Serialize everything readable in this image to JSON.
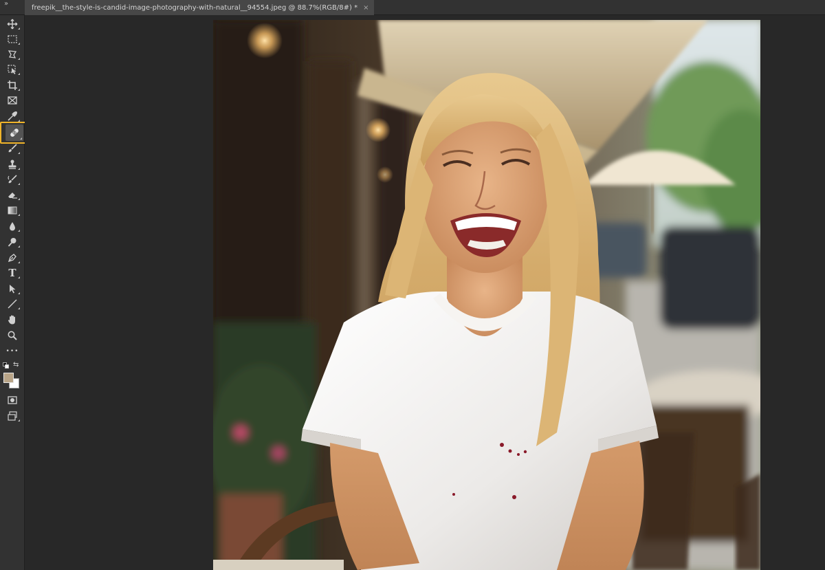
{
  "document": {
    "tab_title": "freepik__the-style-is-candid-image-photography-with-natural__94554.jpeg @ 88.7%(RGB/8#) *",
    "close_glyph": "×"
  },
  "toolbar": {
    "collapse_glyph": "»",
    "tools": [
      {
        "name": "move-tool",
        "icon": "move-icon"
      },
      {
        "name": "rectangular-marquee-tool",
        "icon": "marquee-icon"
      },
      {
        "name": "lasso-tool",
        "icon": "lasso-icon"
      },
      {
        "name": "object-selection-tool",
        "icon": "object-select-icon"
      },
      {
        "name": "crop-tool",
        "icon": "crop-icon"
      },
      {
        "name": "frame-tool",
        "icon": "frame-icon"
      },
      {
        "name": "eyedropper-tool",
        "icon": "eyedropper-icon"
      },
      {
        "name": "spot-healing-brush-tool",
        "icon": "bandage-icon",
        "selected": true
      },
      {
        "name": "brush-tool",
        "icon": "brush-icon"
      },
      {
        "name": "clone-stamp-tool",
        "icon": "stamp-icon"
      },
      {
        "name": "history-brush-tool",
        "icon": "history-brush-icon"
      },
      {
        "name": "eraser-tool",
        "icon": "eraser-icon"
      },
      {
        "name": "gradient-tool",
        "icon": "gradient-icon"
      },
      {
        "name": "blur-tool",
        "icon": "drop-icon"
      },
      {
        "name": "dodge-tool",
        "icon": "dodge-icon"
      },
      {
        "name": "pen-tool",
        "icon": "pen-icon"
      },
      {
        "name": "type-tool",
        "icon": "type-icon"
      },
      {
        "name": "path-selection-tool",
        "icon": "arrow-icon"
      },
      {
        "name": "line-tool",
        "icon": "line-icon"
      },
      {
        "name": "hand-tool",
        "icon": "hand-icon"
      },
      {
        "name": "zoom-tool",
        "icon": "zoom-icon"
      },
      {
        "name": "edit-toolbar",
        "icon": "more-icon"
      }
    ],
    "type_glyph": "T",
    "more_glyph": "•••",
    "swap_glyph": "⇆",
    "foreground_color": "#b8a487",
    "background_color": "#ffffff",
    "highlight_color": "#f0b429"
  },
  "colors": {
    "app_bg": "#282828",
    "panel_bg": "#323232",
    "tab_bg": "#474747"
  }
}
